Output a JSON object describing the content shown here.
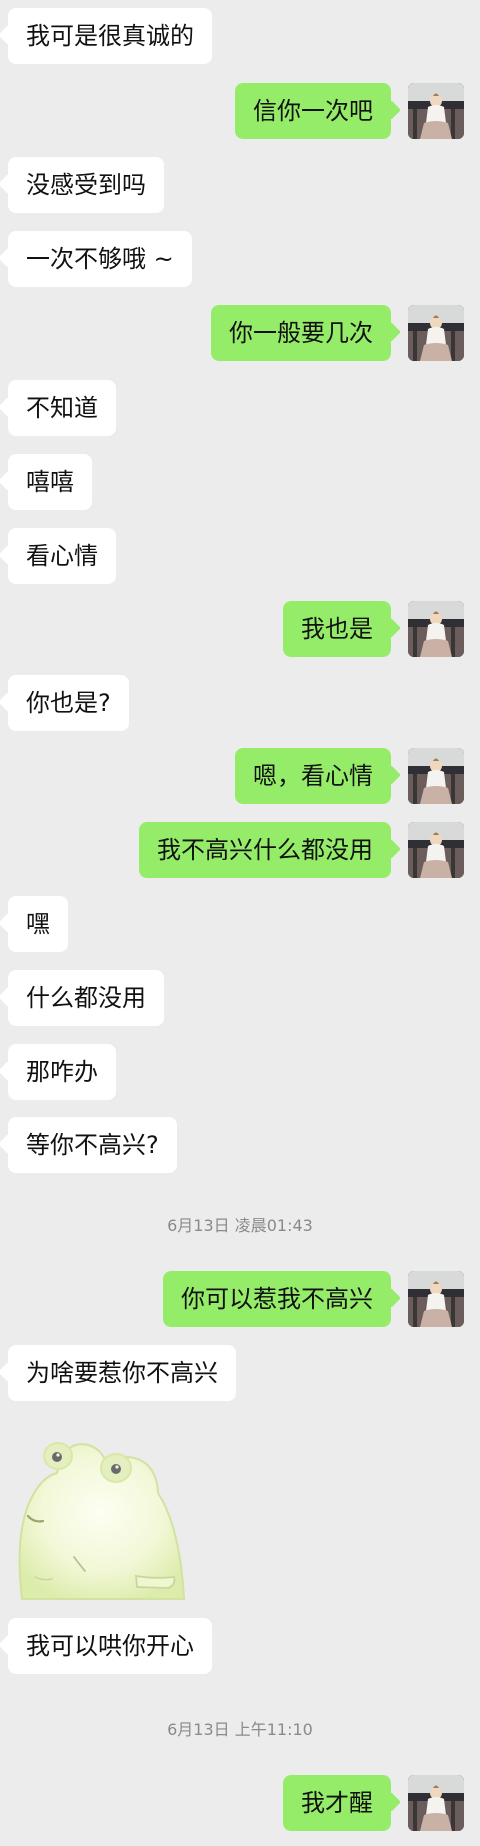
{
  "messages": [
    {
      "side": "in",
      "text": "我可是很真诚的"
    },
    {
      "side": "out",
      "text": "信你一次吧",
      "avatar": "user-avatar"
    },
    {
      "side": "in",
      "text": "没感受到吗"
    },
    {
      "side": "in",
      "text": "一次不够哦 ~"
    },
    {
      "side": "out",
      "text": "你一般要几次",
      "avatar": "user-avatar"
    },
    {
      "side": "in",
      "text": "不知道"
    },
    {
      "side": "in",
      "text": "嘻嘻"
    },
    {
      "side": "in",
      "text": "看心情"
    },
    {
      "side": "out",
      "text": "我也是",
      "avatar": "user-avatar"
    },
    {
      "side": "in",
      "text": "你也是?"
    },
    {
      "side": "out",
      "text": "嗯，看心情",
      "avatar": "user-avatar"
    },
    {
      "side": "out",
      "text": "我不高兴什么都没用",
      "avatar": "user-avatar"
    },
    {
      "side": "in",
      "text": "嘿"
    },
    {
      "side": "in",
      "text": "什么都没用"
    },
    {
      "side": "in",
      "text": "那咋办"
    },
    {
      "side": "in",
      "text": "等你不高兴?"
    },
    {
      "side": "time",
      "text": "6月13日 凌晨01:43"
    },
    {
      "side": "out",
      "text": "你可以惹我不高兴",
      "avatar": "user-avatar"
    },
    {
      "side": "in",
      "text": "为啥要惹你不高兴"
    },
    {
      "side": "sticker",
      "sticker": "frog-sticker"
    },
    {
      "side": "in",
      "text": "我可以哄你开心"
    },
    {
      "side": "time",
      "text": "6月13日 上午11:10"
    },
    {
      "side": "out",
      "text": "我才醒",
      "avatar": "user-avatar"
    }
  ],
  "colors": {
    "background": "#ececec",
    "incoming_bubble": "#ffffff",
    "outgoing_bubble": "#95ec69",
    "timestamp_text": "#8a8a8a"
  }
}
